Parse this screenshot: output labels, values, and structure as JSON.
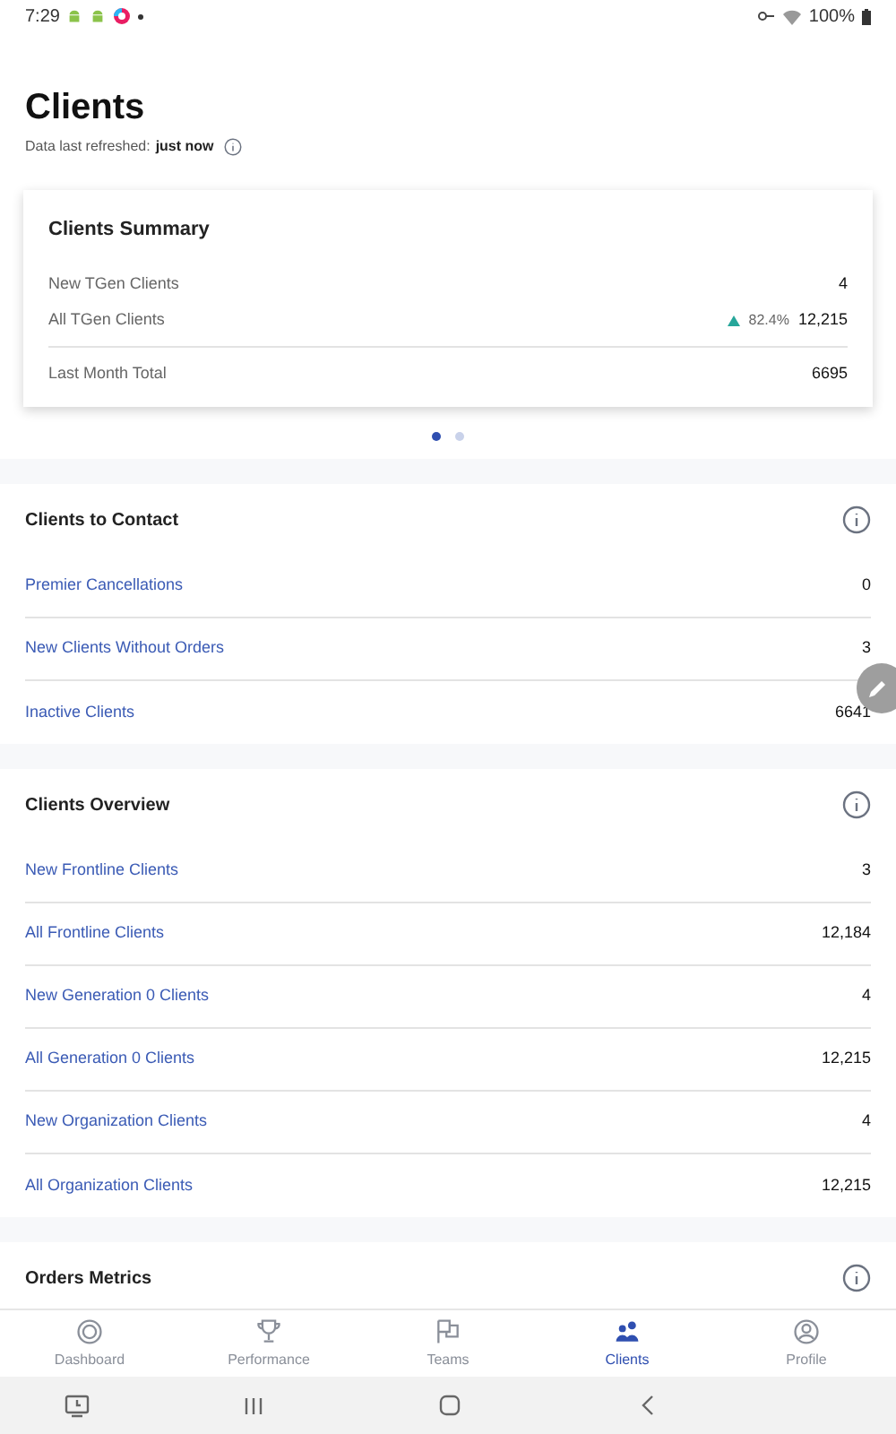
{
  "status_bar": {
    "time": "7:29",
    "battery": "100%"
  },
  "header": {
    "title": "Clients",
    "refreshed_label": "Data last refreshed:",
    "refreshed_value": "just now"
  },
  "summary": {
    "title": "Clients Summary",
    "rows": [
      {
        "label": "New TGen Clients",
        "value": "4"
      },
      {
        "label": "All TGen Clients",
        "change": "82.4%",
        "value": "12,215"
      }
    ],
    "total": {
      "label": "Last Month Total",
      "value": "6695"
    },
    "pages": [
      {
        "selected": true
      },
      {
        "selected": false
      }
    ]
  },
  "sections": [
    {
      "title": "Clients to Contact",
      "rows": [
        {
          "label": "Premier Cancellations",
          "value": "0"
        },
        {
          "label": "New Clients Without Orders",
          "value": "3"
        },
        {
          "label": "Inactive Clients",
          "value": "6641"
        }
      ]
    },
    {
      "title": "Clients Overview",
      "rows": [
        {
          "label": "New Frontline Clients",
          "value": "3"
        },
        {
          "label": "All Frontline Clients",
          "value": "12,184"
        },
        {
          "label": "New Generation 0 Clients",
          "value": "4"
        },
        {
          "label": "All Generation 0 Clients",
          "value": "12,215"
        },
        {
          "label": "New Organization Clients",
          "value": "4"
        },
        {
          "label": "All Organization Clients",
          "value": "12,215"
        }
      ]
    },
    {
      "title": "Orders Metrics"
    }
  ],
  "tabs": [
    {
      "label": "Dashboard",
      "kind": "dashboard",
      "selected": false
    },
    {
      "label": "Performance",
      "kind": "trophy",
      "selected": false
    },
    {
      "label": "Teams",
      "kind": "flags",
      "selected": false
    },
    {
      "label": "Clients",
      "kind": "people",
      "selected": true
    },
    {
      "label": "Profile",
      "kind": "profile",
      "selected": false
    }
  ]
}
